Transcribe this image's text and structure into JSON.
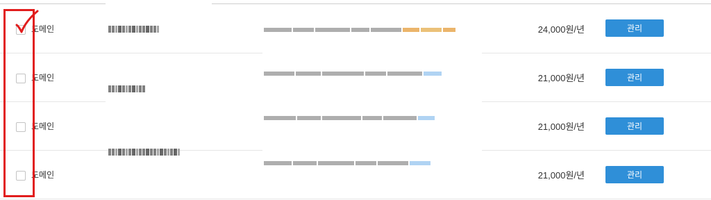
{
  "rows": [
    {
      "type": "도메인",
      "price": "24,000원/년",
      "manage": "관리",
      "checked": true
    },
    {
      "type": "도메인",
      "price": "21,000원/년",
      "manage": "관리",
      "checked": false
    },
    {
      "type": "도메인",
      "price": "21,000원/년",
      "manage": "관리",
      "checked": false
    },
    {
      "type": "도메인",
      "price": "21,000원/년",
      "manage": "관리",
      "checked": false
    }
  ],
  "colors": {
    "button": "#2f8fd8",
    "annotation": "#e11d1d",
    "separator": "#e6e6e6"
  },
  "icons": {
    "annotation_check": "check-mark-icon"
  }
}
